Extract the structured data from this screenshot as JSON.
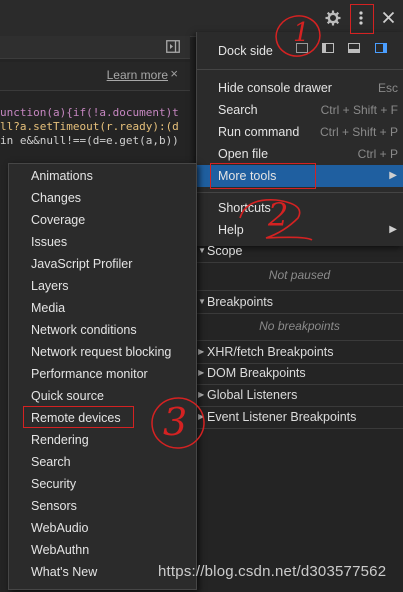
{
  "code_panel": {
    "learn_more": "Learn more",
    "close": "×",
    "line1": "unction(a){if(!a.document)t",
    "line2": "ll?a.setTimeout(r.ready):(d",
    "line3": "in e&&null!==(d=e.get(a,b))"
  },
  "menu": {
    "dock_side_label": "Dock side",
    "items": [
      {
        "label": "Hide console drawer",
        "shortcut": "Esc"
      },
      {
        "label": "Search",
        "shortcut": "Ctrl + Shift + F"
      },
      {
        "label": "Run command",
        "shortcut": "Ctrl + Shift + P"
      },
      {
        "label": "Open file",
        "shortcut": "Ctrl + P"
      },
      {
        "label": "More tools",
        "shortcut": ""
      },
      {
        "label": "Shortcuts",
        "shortcut": ""
      },
      {
        "label": "Help",
        "shortcut": ""
      }
    ]
  },
  "panes": {
    "scope": "Scope",
    "scope_empty": "Not paused",
    "breakpoints": "Breakpoints",
    "breakpoints_empty": "No breakpoints",
    "xhr": "XHR/fetch Breakpoints",
    "dom": "DOM Breakpoints",
    "global": "Global Listeners",
    "event": "Event Listener Breakpoints"
  },
  "submenu": {
    "items": [
      "Animations",
      "Changes",
      "Coverage",
      "Issues",
      "JavaScript Profiler",
      "Layers",
      "Media",
      "Network conditions",
      "Network request blocking",
      "Performance monitor",
      "Quick source",
      "Remote devices",
      "Rendering",
      "Search",
      "Security",
      "Sensors",
      "WebAudio",
      "WebAuthn",
      "What's New"
    ]
  },
  "annotations": {
    "num1": "1",
    "num2": "2",
    "num3": "3",
    "watermark": "https://blog.csdn.net/d303577562"
  },
  "colors": {
    "highlight": "#1f5fa0",
    "annotation": "#d42222"
  }
}
